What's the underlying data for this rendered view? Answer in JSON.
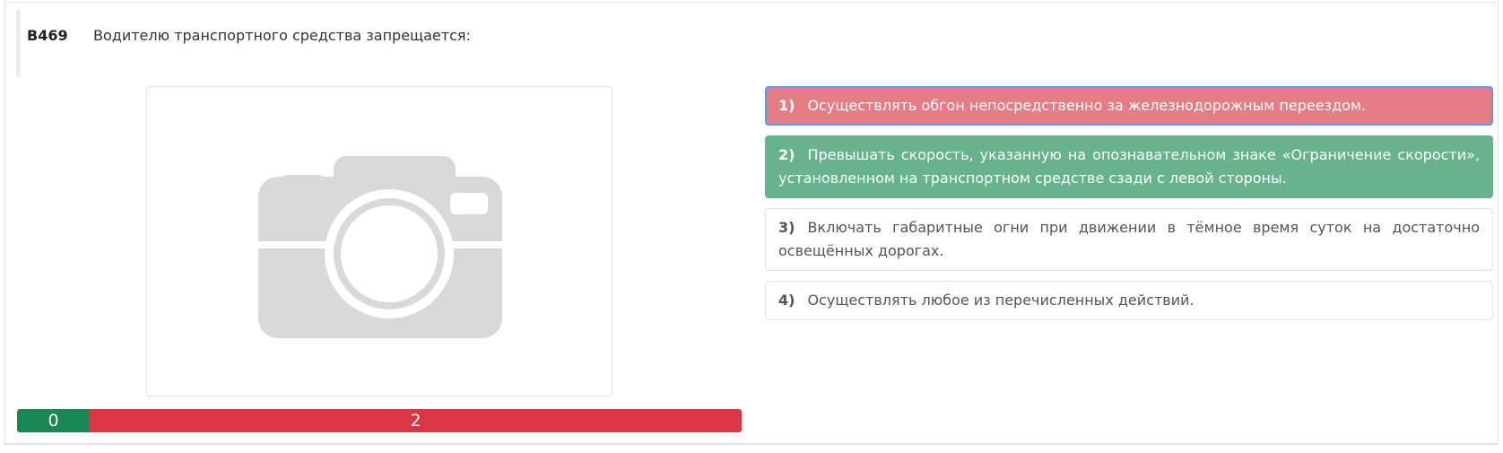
{
  "question": {
    "number": "B469",
    "text": "Водителю транспортного средства запрещается:"
  },
  "image": {
    "icon": "camera-placeholder-icon"
  },
  "score": {
    "correct": "0",
    "wrong": "2",
    "correct_color": "#198754",
    "wrong_color": "#dc3545"
  },
  "answers": [
    {
      "num": "1)",
      "text": "Осуществлять обгон непосредственно за железнодорожным переездом.",
      "state": "wrong-selected"
    },
    {
      "num": "2)",
      "text": "Превышать скорость, указанную на опознавательном знаке «Ограничение скорости», установленном на транспортном средстве сзади с левой стороны.",
      "state": "correct"
    },
    {
      "num": "3)",
      "text": "Включать габаритные огни при движении в тёмное время суток на достаточно освещённых дорогах.",
      "state": "neutral"
    },
    {
      "num": "4)",
      "text": "Осуществлять любое из перечисленных действий.",
      "state": "neutral"
    }
  ],
  "colors": {
    "wrong_answer": "#e57d84",
    "correct_answer": "#66b38e",
    "selected_outline": "#5b9bf0"
  }
}
